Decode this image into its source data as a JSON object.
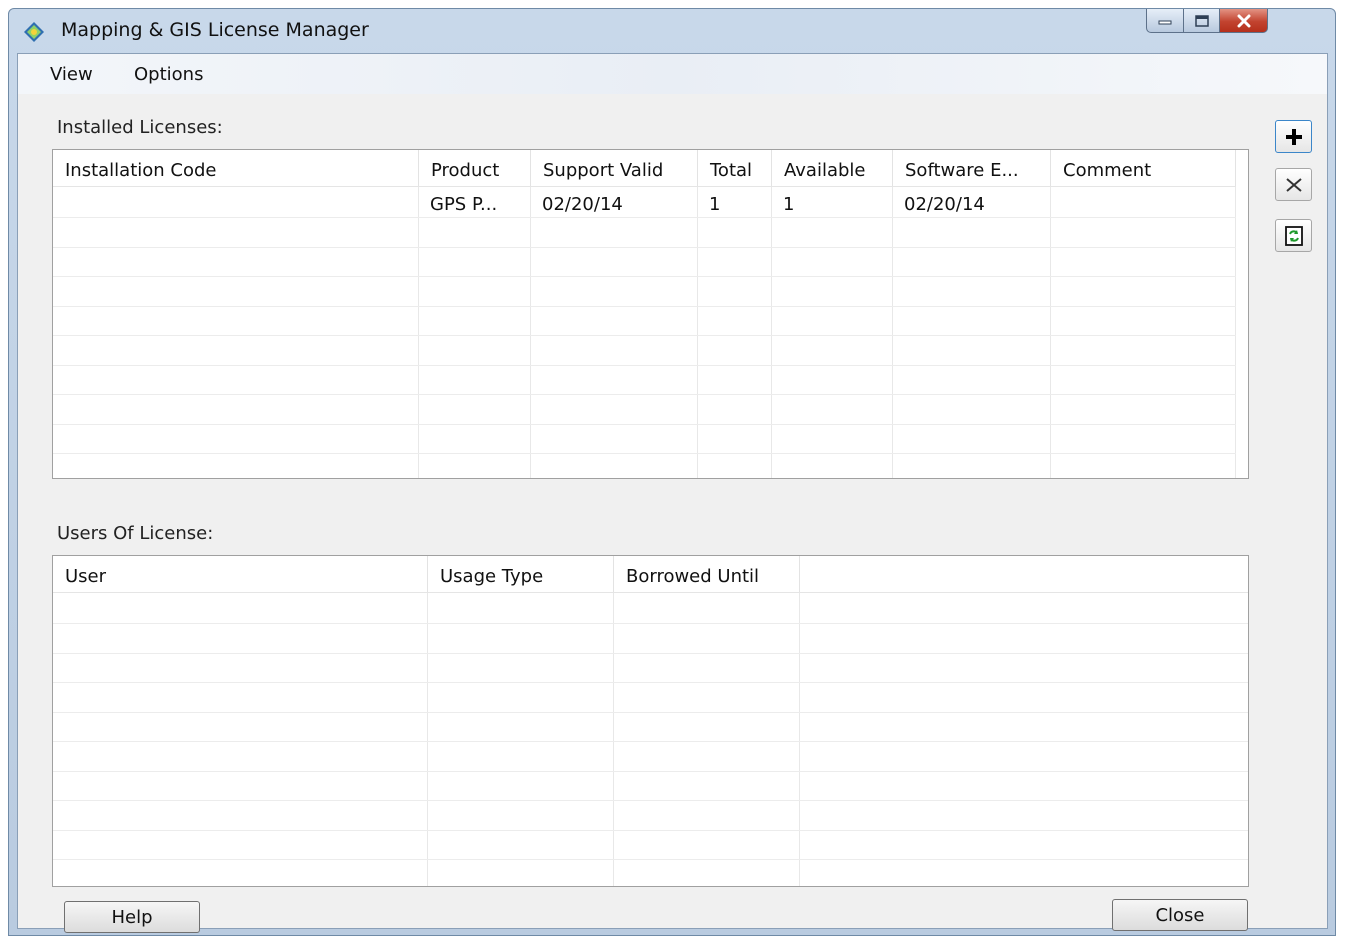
{
  "window": {
    "title": "Mapping & GIS License Manager"
  },
  "menu": [
    {
      "label": "View"
    },
    {
      "label": "Options"
    }
  ],
  "installed": {
    "label": "Installed Licenses:",
    "columns": [
      "Installation Code",
      "Product",
      "Support Valid",
      "Total",
      "Available",
      "Software E...",
      "Comment"
    ],
    "rows": [
      [
        "",
        "GPS P...",
        "02/20/14",
        "1",
        "1",
        "02/20/14",
        ""
      ]
    ]
  },
  "users": {
    "label": "Users Of License:",
    "columns": [
      "User",
      "Usage Type",
      "Borrowed Until"
    ],
    "rows": []
  },
  "side_buttons": {
    "add": "plus-icon",
    "remove": "x-icon",
    "refresh": "refresh-icon"
  },
  "buttons": {
    "help": "Help",
    "close": "Close"
  },
  "colors": {
    "title_bar": "#b9cbe0",
    "close_button": "#c2432f",
    "client_bg": "#f0f0f0",
    "refresh_accent": "#1f9a2b"
  }
}
